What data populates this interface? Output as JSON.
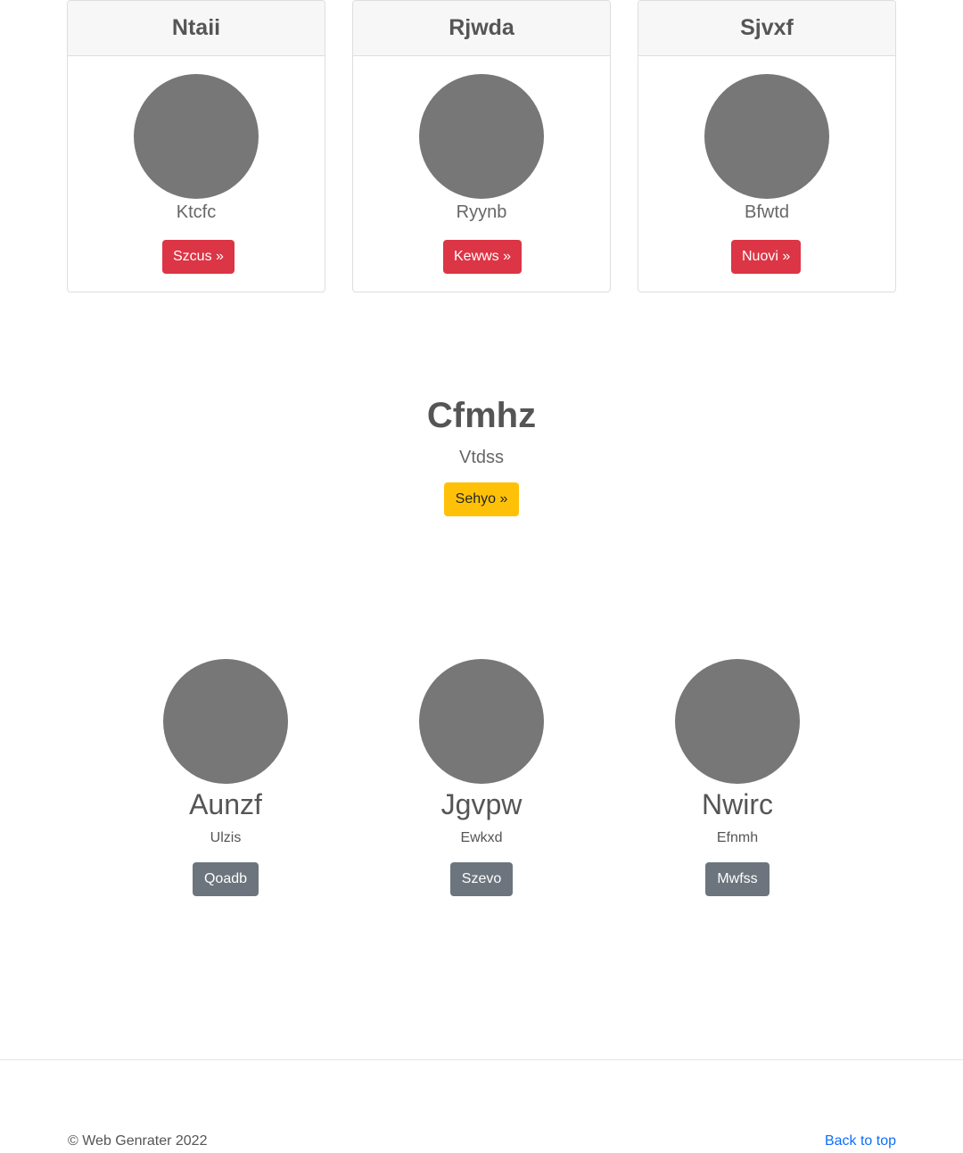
{
  "cards": [
    {
      "title": "Ntaii",
      "subtitle": "Ktcfc",
      "button": "Szcus »"
    },
    {
      "title": "Rjwda",
      "subtitle": "Ryynb",
      "button": "Kewws »"
    },
    {
      "title": "Sjvxf",
      "subtitle": "Bfwtd",
      "button": "Nuovi »"
    }
  ],
  "hero": {
    "title": "Cfmhz",
    "subtitle": "Vtdss",
    "button": "Sehyo »"
  },
  "features": [
    {
      "title": "Aunzf",
      "subtitle": "Ulzis",
      "button": "Qoadb"
    },
    {
      "title": "Jgvpw",
      "subtitle": "Ewkxd",
      "button": "Szevo"
    },
    {
      "title": "Nwirc",
      "subtitle": "Efnmh",
      "button": "Mwfss"
    }
  ],
  "footer": {
    "copyright": "© Web Genrater 2022",
    "back_to_top": "Back to top"
  },
  "colors": {
    "danger": "#dc3545",
    "warning": "#ffc107",
    "secondary": "#6c757d",
    "avatar": "#777777",
    "link": "#0d6efd"
  }
}
